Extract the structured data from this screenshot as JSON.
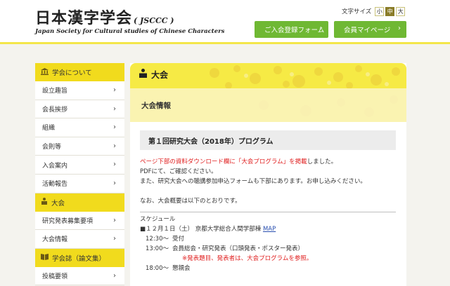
{
  "header": {
    "title": "日本漢字学会",
    "title_abbr": "( JSCCC )",
    "subtitle": "Japan Society for Cultural studies of Chinese Characters",
    "font_size_label": "文字サイズ",
    "font_sizes": [
      "小",
      "中",
      "大"
    ],
    "font_size_selected": "中",
    "register_button": "ご入会登録フォーム",
    "mypage_button": "会員マイページ",
    "arrow": "›"
  },
  "sidebar": {
    "sections": [
      {
        "heading": "学会について",
        "items": [
          "設立趣旨",
          "会長挨拶",
          "組織",
          "会則等",
          "入会案内",
          "活動報告"
        ]
      },
      {
        "heading": "大会",
        "items": [
          "研究発表募集要項",
          "大会情報"
        ]
      },
      {
        "heading": "学会誌（論文集）",
        "items": [
          "投稿要領"
        ]
      }
    ],
    "chevron": "›"
  },
  "main": {
    "banner_title": "大会",
    "banner_subtitle": "大会情報",
    "program_title": "第１回研究大会（2018年）プログラム",
    "intro_red": "ページ下部の資料ダウンロード欄に「大会プログラム」を掲載",
    "intro_rest": "しました。",
    "line2": "PDFにて、ご確認ください。",
    "line3": "また、研究大会への聴講参加申込フォームも下部にあります。お申し込みください。",
    "line4": "なお、大会概要は以下のとおりです。",
    "schedule_label": "スケジュール",
    "date_line": "■１２月１日（土） 京都大学総合人間学部棟",
    "map_link": "MAP",
    "schedule": [
      {
        "time": "12:30～",
        "text": "受付"
      },
      {
        "time": "13:00～",
        "text": "会員総会・研究発表（口頭発表・ポスター発表）"
      }
    ],
    "note_red": "※発表題目、発表者は、大会プログラムを参照。",
    "last_time": "18:00～",
    "last_text": "懇親会"
  },
  "colors": {
    "accent_yellow": "#f1db1d",
    "button_green": "#6fb833",
    "note_red": "#e02020",
    "link_blue": "#2a50b0"
  }
}
